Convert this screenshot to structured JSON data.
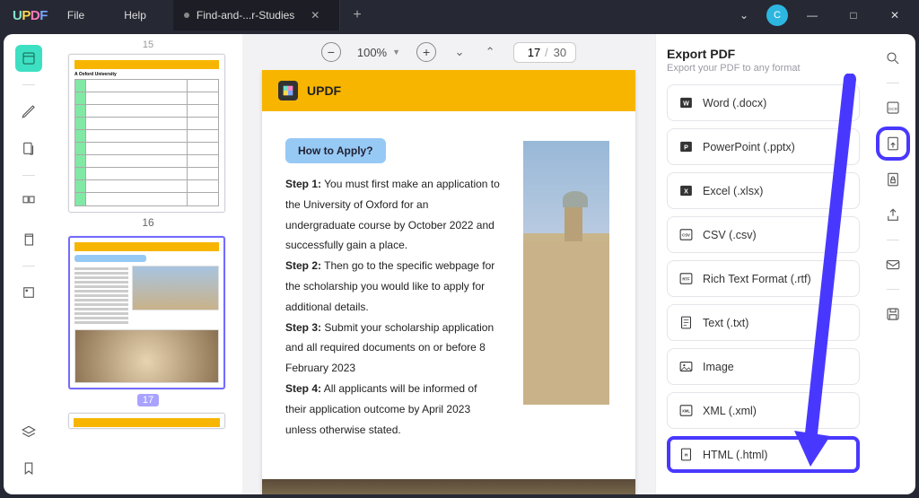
{
  "titlebar": {
    "menu_file": "File",
    "menu_help": "Help",
    "tab_title": "Find-and-...r-Studies",
    "avatar_letter": "C"
  },
  "viewer": {
    "zoom": "100%",
    "page_current": "17",
    "page_total": "30"
  },
  "thumbs": {
    "top_num": "15",
    "label1": "16",
    "label2": "17",
    "thumb1_heading": "A Oxford University"
  },
  "page": {
    "brand": "UPDF",
    "chip": "How to Apply?",
    "step1_b": "Step 1:",
    "step1": " You must first make an application to the University of Oxford for an undergraduate course by October 2022 and successfully gain a place.",
    "step2_b": "Step 2:",
    "step2": " Then go to the specific webpage for the scholarship you would like to apply for additional details.",
    "step3_b": "Step 3:",
    "step3": " Submit your scholarship application and all required documents on or before 8 February 2023",
    "step4_b": "Step 4:",
    "step4": " All applicants will be informed of their application outcome by April 2023 unless otherwise stated."
  },
  "export": {
    "title": "Export PDF",
    "subtitle": "Export your PDF to any format",
    "items": {
      "word": "Word (.docx)",
      "ppt": "PowerPoint (.pptx)",
      "excel": "Excel (.xlsx)",
      "csv": "CSV (.csv)",
      "rtf": "Rich Text Format (.rtf)",
      "txt": "Text (.txt)",
      "image": "Image",
      "xml": "XML (.xml)",
      "html": "HTML (.html)"
    }
  }
}
